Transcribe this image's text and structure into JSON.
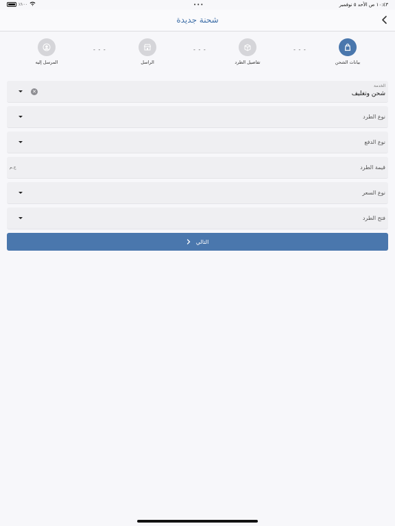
{
  "status_bar": {
    "time_date": "١٠:٤٣ ص   الأحد ٥ نوفمبر",
    "battery": "٪١٠٠"
  },
  "nav": {
    "title": "شحنة جديدة",
    "back_icon": "chevron-left-icon"
  },
  "steps": [
    {
      "label": "بيانات الشحن",
      "icon": "bag-icon",
      "active": true
    },
    {
      "label": "تفاصيل الطرد",
      "icon": "box-icon",
      "active": false
    },
    {
      "label": "الراسل",
      "icon": "store-icon",
      "active": false
    },
    {
      "label": "المرسل إليه",
      "icon": "person-icon",
      "active": false
    }
  ],
  "step_separator": "- - -",
  "form": {
    "service": {
      "label": "الخدمة",
      "value": "شحن وتغليف"
    },
    "package_type": {
      "label": "نوع الطرد"
    },
    "payment_type": {
      "label": "نوع الدفع"
    },
    "package_value": {
      "label": "قيمة الطرد",
      "suffix": "ج.م"
    },
    "price_type": {
      "label": "نوع السعر"
    },
    "open_package": {
      "label": "فتح الطرد"
    }
  },
  "next_button": {
    "label": "التالي"
  },
  "colors": {
    "accent": "#4a77ad",
    "inactive": "#d5d5d9"
  }
}
